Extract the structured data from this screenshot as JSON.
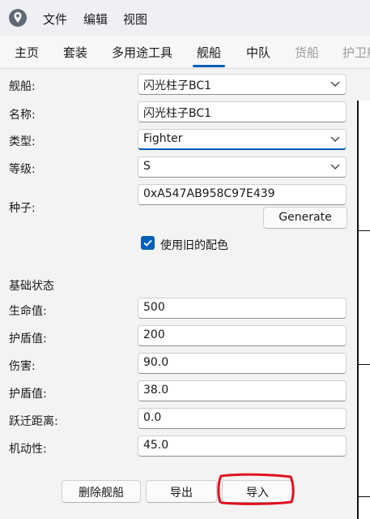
{
  "menu": [
    "文件",
    "编辑",
    "视图"
  ],
  "tabs": [
    {
      "label": "主页",
      "disabled": false
    },
    {
      "label": "套装",
      "disabled": false
    },
    {
      "label": "多用途工具",
      "disabled": false
    },
    {
      "label": "舰船",
      "disabled": false
    },
    {
      "label": "中队",
      "disabled": false
    },
    {
      "label": "货船",
      "disabled": true
    },
    {
      "label": "护卫舰",
      "disabled": true
    }
  ],
  "active_tab": "舰船",
  "form": {
    "ship": {
      "label": "舰船:",
      "value": "闪光柱子BC1"
    },
    "name": {
      "label": "名称:",
      "value": "闪光柱子BC1"
    },
    "type": {
      "label": "类型:",
      "value": "Fighter"
    },
    "grade": {
      "label": "等级:",
      "value": "S"
    },
    "seed": {
      "label": "种子:",
      "value": "0xA547AB958C97E439",
      "generate_label": "Generate"
    },
    "old_colors": {
      "label": "使用旧的配色",
      "checked": true
    }
  },
  "base_stats": {
    "title": "基础状态",
    "rows": [
      {
        "label": "生命值:",
        "value": "500"
      },
      {
        "label": "护盾值:",
        "value": "200"
      },
      {
        "label": "伤害:",
        "value": "90.0"
      },
      {
        "label": "护盾值:",
        "value": "38.0"
      },
      {
        "label": "跃迁距离:",
        "value": "0.0"
      },
      {
        "label": "机动性:",
        "value": "45.0"
      }
    ]
  },
  "actions": {
    "delete": "删除舰船",
    "export": "导出",
    "import": "导入"
  },
  "colors": {
    "accent": "#005fb8",
    "annotation_red": "#e0101e"
  },
  "icons": {
    "app": "app-logo-icon",
    "dropdown": "chevron-down-icon",
    "check": "check-icon"
  }
}
